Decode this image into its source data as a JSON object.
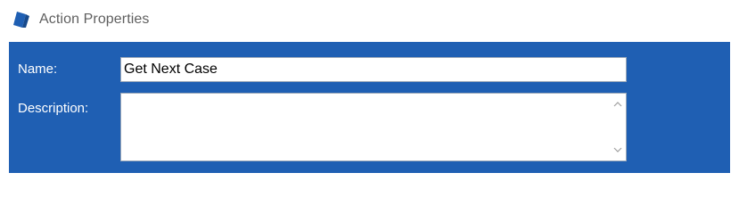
{
  "window": {
    "title": "Action Properties",
    "icon": "app-logo-icon"
  },
  "form": {
    "name_label": "Name:",
    "name_value": "Get Next Case",
    "description_label": "Description:",
    "description_value": ""
  },
  "scrollbar": {
    "up_icon": "chevron-up-icon",
    "down_icon": "chevron-down-icon"
  },
  "colors": {
    "panel": "#1f5fb3",
    "icon": "#1f5fb3",
    "title_text": "#5f5f5f"
  }
}
